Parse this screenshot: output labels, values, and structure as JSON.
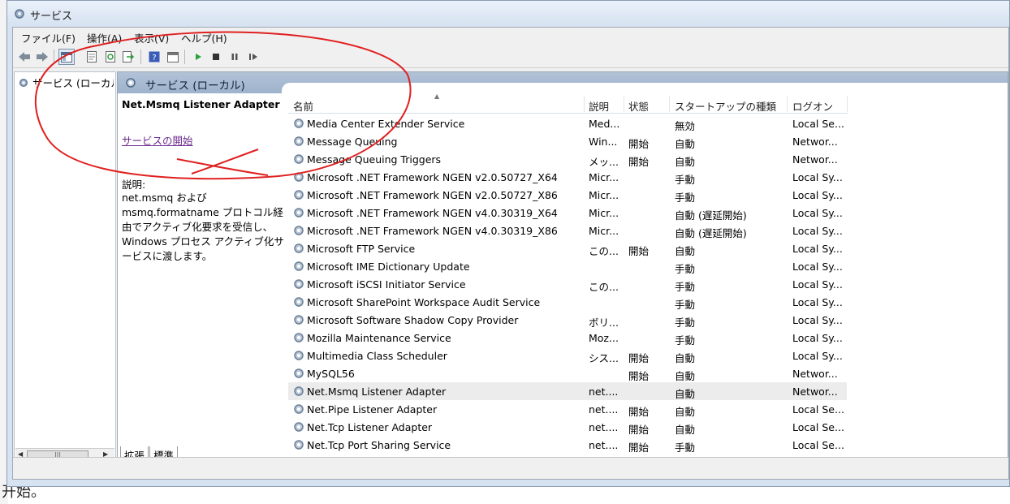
{
  "window": {
    "title": "サービス"
  },
  "menu": [
    "ファイル(F)",
    "操作(A)",
    "表示(V)",
    "ヘルプ(H)"
  ],
  "tree": {
    "item": "サービス (ローカル)"
  },
  "content_header": "サービス (ローカル)",
  "details": {
    "service_name": "Net.Msmq Listener Adapter",
    "start_link": "サービスの開始",
    "description_label": "説明:",
    "description_text": "net.msmq および msmq.formatname プロトコル経由でアクティブ化要求を受信し、Windows プロセス アクティブ化サービスに渡します。"
  },
  "columns": [
    "名前",
    "説明",
    "状態",
    "スタートアップの種類",
    "ログオン"
  ],
  "services": [
    {
      "name": "Media Center Extender Service",
      "desc": "Med...",
      "state": "",
      "startup": "無効",
      "logon": "Local Se..."
    },
    {
      "name": "Message Queuing",
      "desc": "Win...",
      "state": "開始",
      "startup": "自動",
      "logon": "Networ..."
    },
    {
      "name": "Message Queuing Triggers",
      "desc": "メッ...",
      "state": "開始",
      "startup": "自動",
      "logon": "Networ..."
    },
    {
      "name": "Microsoft .NET Framework NGEN v2.0.50727_X64",
      "desc": "Micr...",
      "state": "",
      "startup": "手動",
      "logon": "Local Sy..."
    },
    {
      "name": "Microsoft .NET Framework NGEN v2.0.50727_X86",
      "desc": "Micr...",
      "state": "",
      "startup": "手動",
      "logon": "Local Sy..."
    },
    {
      "name": "Microsoft .NET Framework NGEN v4.0.30319_X64",
      "desc": "Micr...",
      "state": "",
      "startup": "自動 (遅延開始)",
      "logon": "Local Sy..."
    },
    {
      "name": "Microsoft .NET Framework NGEN v4.0.30319_X86",
      "desc": "Micr...",
      "state": "",
      "startup": "自動 (遅延開始)",
      "logon": "Local Sy..."
    },
    {
      "name": "Microsoft FTP Service",
      "desc": "この...",
      "state": "開始",
      "startup": "自動",
      "logon": "Local Sy..."
    },
    {
      "name": "Microsoft IME Dictionary Update",
      "desc": "",
      "state": "",
      "startup": "手動",
      "logon": "Local Sy..."
    },
    {
      "name": "Microsoft iSCSI Initiator Service",
      "desc": "この...",
      "state": "",
      "startup": "手動",
      "logon": "Local Sy..."
    },
    {
      "name": "Microsoft SharePoint Workspace Audit Service",
      "desc": "",
      "state": "",
      "startup": "手動",
      "logon": "Local Sy..."
    },
    {
      "name": "Microsoft Software Shadow Copy Provider",
      "desc": "ボリ...",
      "state": "",
      "startup": "手動",
      "logon": "Local Sy..."
    },
    {
      "name": "Mozilla Maintenance Service",
      "desc": "Moz...",
      "state": "",
      "startup": "手動",
      "logon": "Local Sy..."
    },
    {
      "name": "Multimedia Class Scheduler",
      "desc": "シス...",
      "state": "開始",
      "startup": "自動",
      "logon": "Local Sy..."
    },
    {
      "name": "MySQL56",
      "desc": "",
      "state": "開始",
      "startup": "自動",
      "logon": "Networ..."
    },
    {
      "name": "Net.Msmq Listener Adapter",
      "desc": "net....",
      "state": "",
      "startup": "自動",
      "logon": "Networ...",
      "selected": true
    },
    {
      "name": "Net.Pipe Listener Adapter",
      "desc": "net....",
      "state": "開始",
      "startup": "自動",
      "logon": "Local Se..."
    },
    {
      "name": "Net.Tcp Listener Adapter",
      "desc": "net....",
      "state": "開始",
      "startup": "自動",
      "logon": "Local Se..."
    },
    {
      "name": "Net.Tcp Port Sharing Service",
      "desc": "net....",
      "state": "開始",
      "startup": "手動",
      "logon": "Local Se..."
    }
  ],
  "bottom_tabs": [
    "拡張",
    "標準"
  ],
  "background_text": "开始。",
  "colors": {
    "annotation": "#e02020",
    "header": "#a9bcd3",
    "link": "#6b2a8f"
  }
}
